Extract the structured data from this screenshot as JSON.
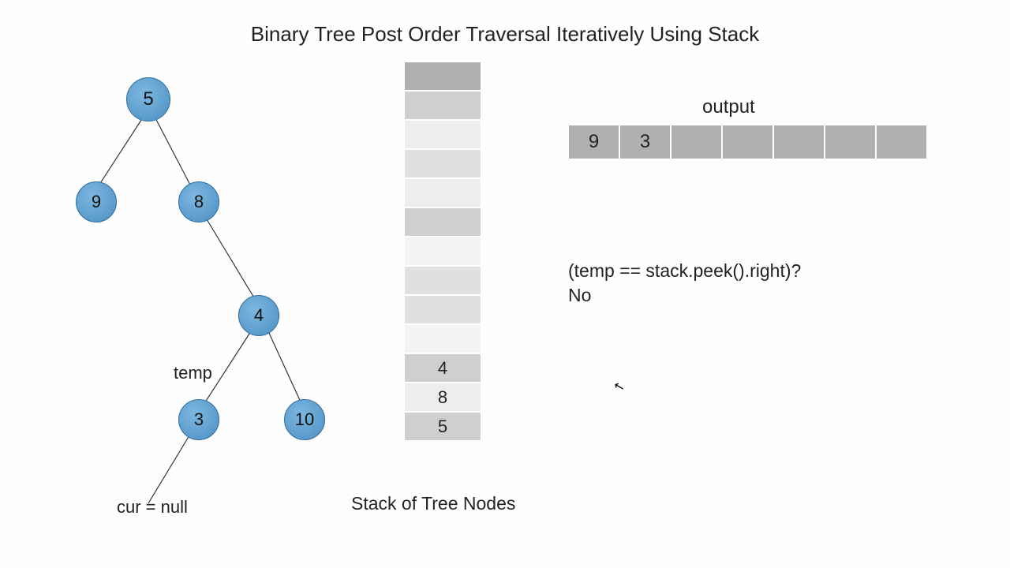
{
  "title": "Binary Tree Post Order Traversal Iteratively Using Stack",
  "tree": {
    "nodes": {
      "n5": "5",
      "n9": "9",
      "n8": "8",
      "n4": "4",
      "n3": "3",
      "n10": "10"
    },
    "labels": {
      "temp": "temp",
      "cur": "cur = null"
    }
  },
  "stack": {
    "cells": [
      "",
      "",
      "",
      "",
      "",
      "",
      "",
      "",
      "",
      "",
      "4",
      "8",
      "5"
    ],
    "shades": [
      "a",
      "b",
      "c",
      "d",
      "c",
      "b",
      "e",
      "d",
      "d",
      "e",
      "b",
      "c",
      "b"
    ],
    "caption": "Stack of Tree Nodes"
  },
  "output": {
    "label": "output",
    "cells": [
      "9",
      "3",
      "",
      "",
      "",
      "",
      ""
    ]
  },
  "condition": {
    "line1": "(temp == stack.peek().right)?",
    "line2": "No"
  },
  "cursor_glyph": "↖"
}
